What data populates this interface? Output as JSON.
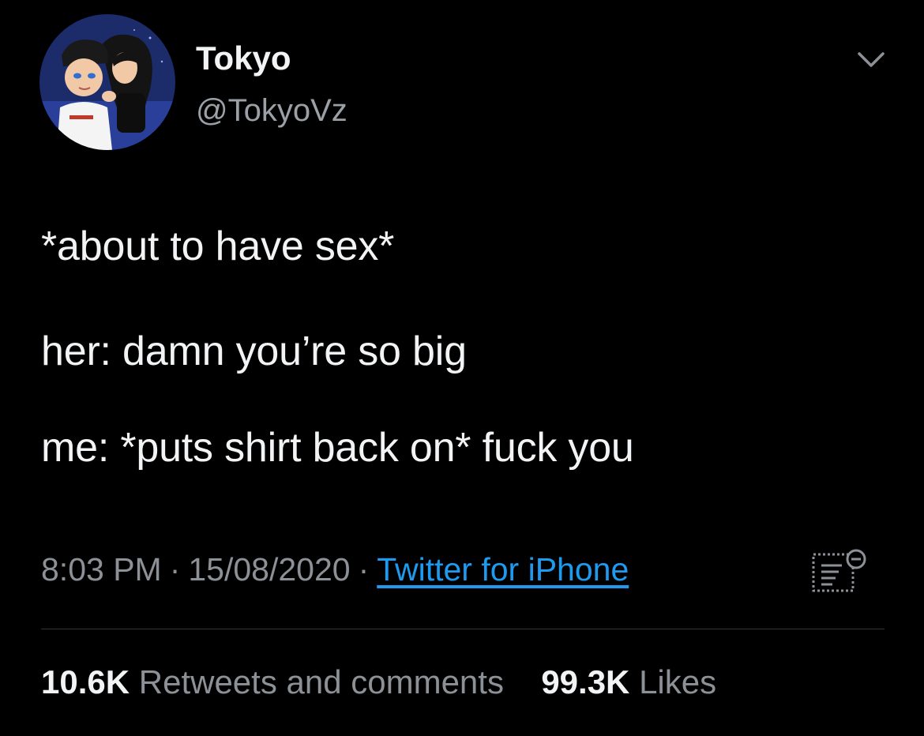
{
  "user": {
    "display_name": "Tokyo",
    "handle": "@TokyoVz",
    "avatar_icon": "cartoon-couple-avatar"
  },
  "tweet": {
    "lines": [
      "*about to have sex*",
      "her: damn you’re so big",
      "me: *puts shirt back on* fuck you"
    ]
  },
  "meta": {
    "time": "8:03 PM",
    "date": "15/08/2020",
    "separator": "·",
    "source": "Twitter for iPhone"
  },
  "stats": {
    "retweets_count": "10.6K",
    "retweets_label": "Retweets and comments",
    "likes_count": "99.3K",
    "likes_label": "Likes"
  },
  "colors": {
    "background": "#000000",
    "text_primary": "#f1f3f4",
    "text_secondary": "#8b9196",
    "link": "#1d9bf0",
    "divider": "#2f3336"
  },
  "icons": {
    "menu": "chevron-down-icon",
    "analytics": "analytics-icon"
  }
}
